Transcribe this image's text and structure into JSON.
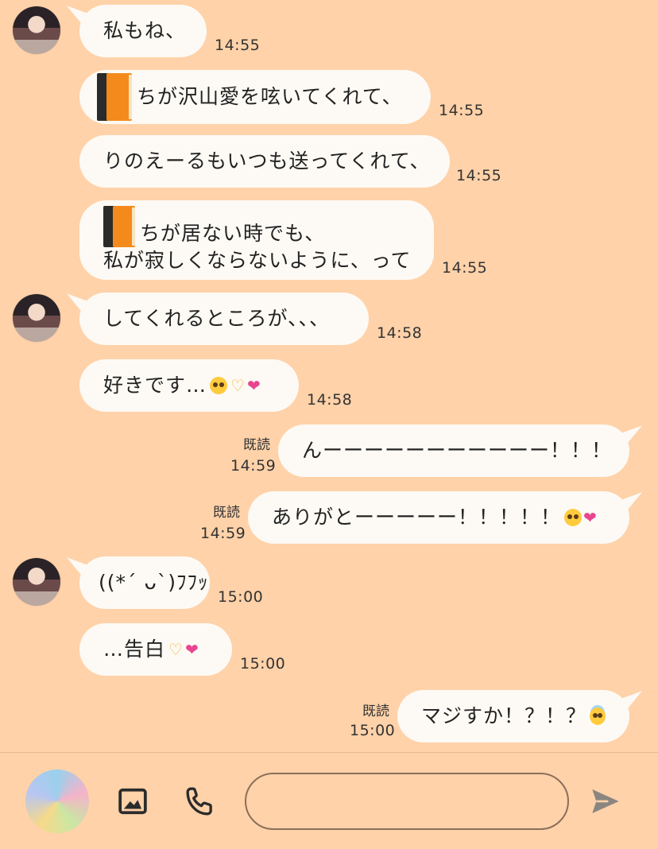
{
  "messages": [
    {
      "side": "left",
      "text": "私もね、",
      "time": "14:55"
    },
    {
      "side": "left",
      "book": "book-icon",
      "text": "ちが沢山愛を呟いてくれて、",
      "time": "14:55"
    },
    {
      "side": "left",
      "text": "りのえーるもいつも送ってくれて、",
      "time": "14:55"
    },
    {
      "side": "left",
      "book": "book-icon",
      "lines": [
        "ちが居ない時でも、",
        "私が寂しくならないように、って"
      ],
      "time": "14:55"
    },
    {
      "side": "left",
      "text": "してくれるところが、、、",
      "time": "14:58"
    },
    {
      "side": "left",
      "text": "好きです…",
      "emoji": [
        "pleading-face",
        "heart-hands",
        "two-hearts"
      ],
      "time": "14:58"
    },
    {
      "side": "right",
      "read": "既読",
      "text": "んーーーーーーーーーーー！！！",
      "time": "14:59"
    },
    {
      "side": "right",
      "read": "既読",
      "text": "ありがとーーーーー！！！！！",
      "emoji": [
        "pleading-face",
        "sparkling-heart"
      ],
      "time": "14:59"
    },
    {
      "side": "left",
      "text": "((*´ ᴗ`)ﾌﾌｯ",
      "time": "15:00"
    },
    {
      "side": "left",
      "text": "…告白",
      "emoji": [
        "heart-hands",
        "two-hearts"
      ],
      "time": "15:00"
    },
    {
      "side": "right",
      "read": "既読",
      "text": "マジすか！？！？",
      "emoji": [
        "smiling-face-with-halo"
      ],
      "time": "15:00"
    }
  ],
  "input": {
    "placeholder": ""
  },
  "icons": {
    "image": "image-icon",
    "phone": "phone-icon",
    "send": "send-icon"
  },
  "colors": {
    "background": "#FFD2A9",
    "bubble": "#FDFAF5"
  }
}
